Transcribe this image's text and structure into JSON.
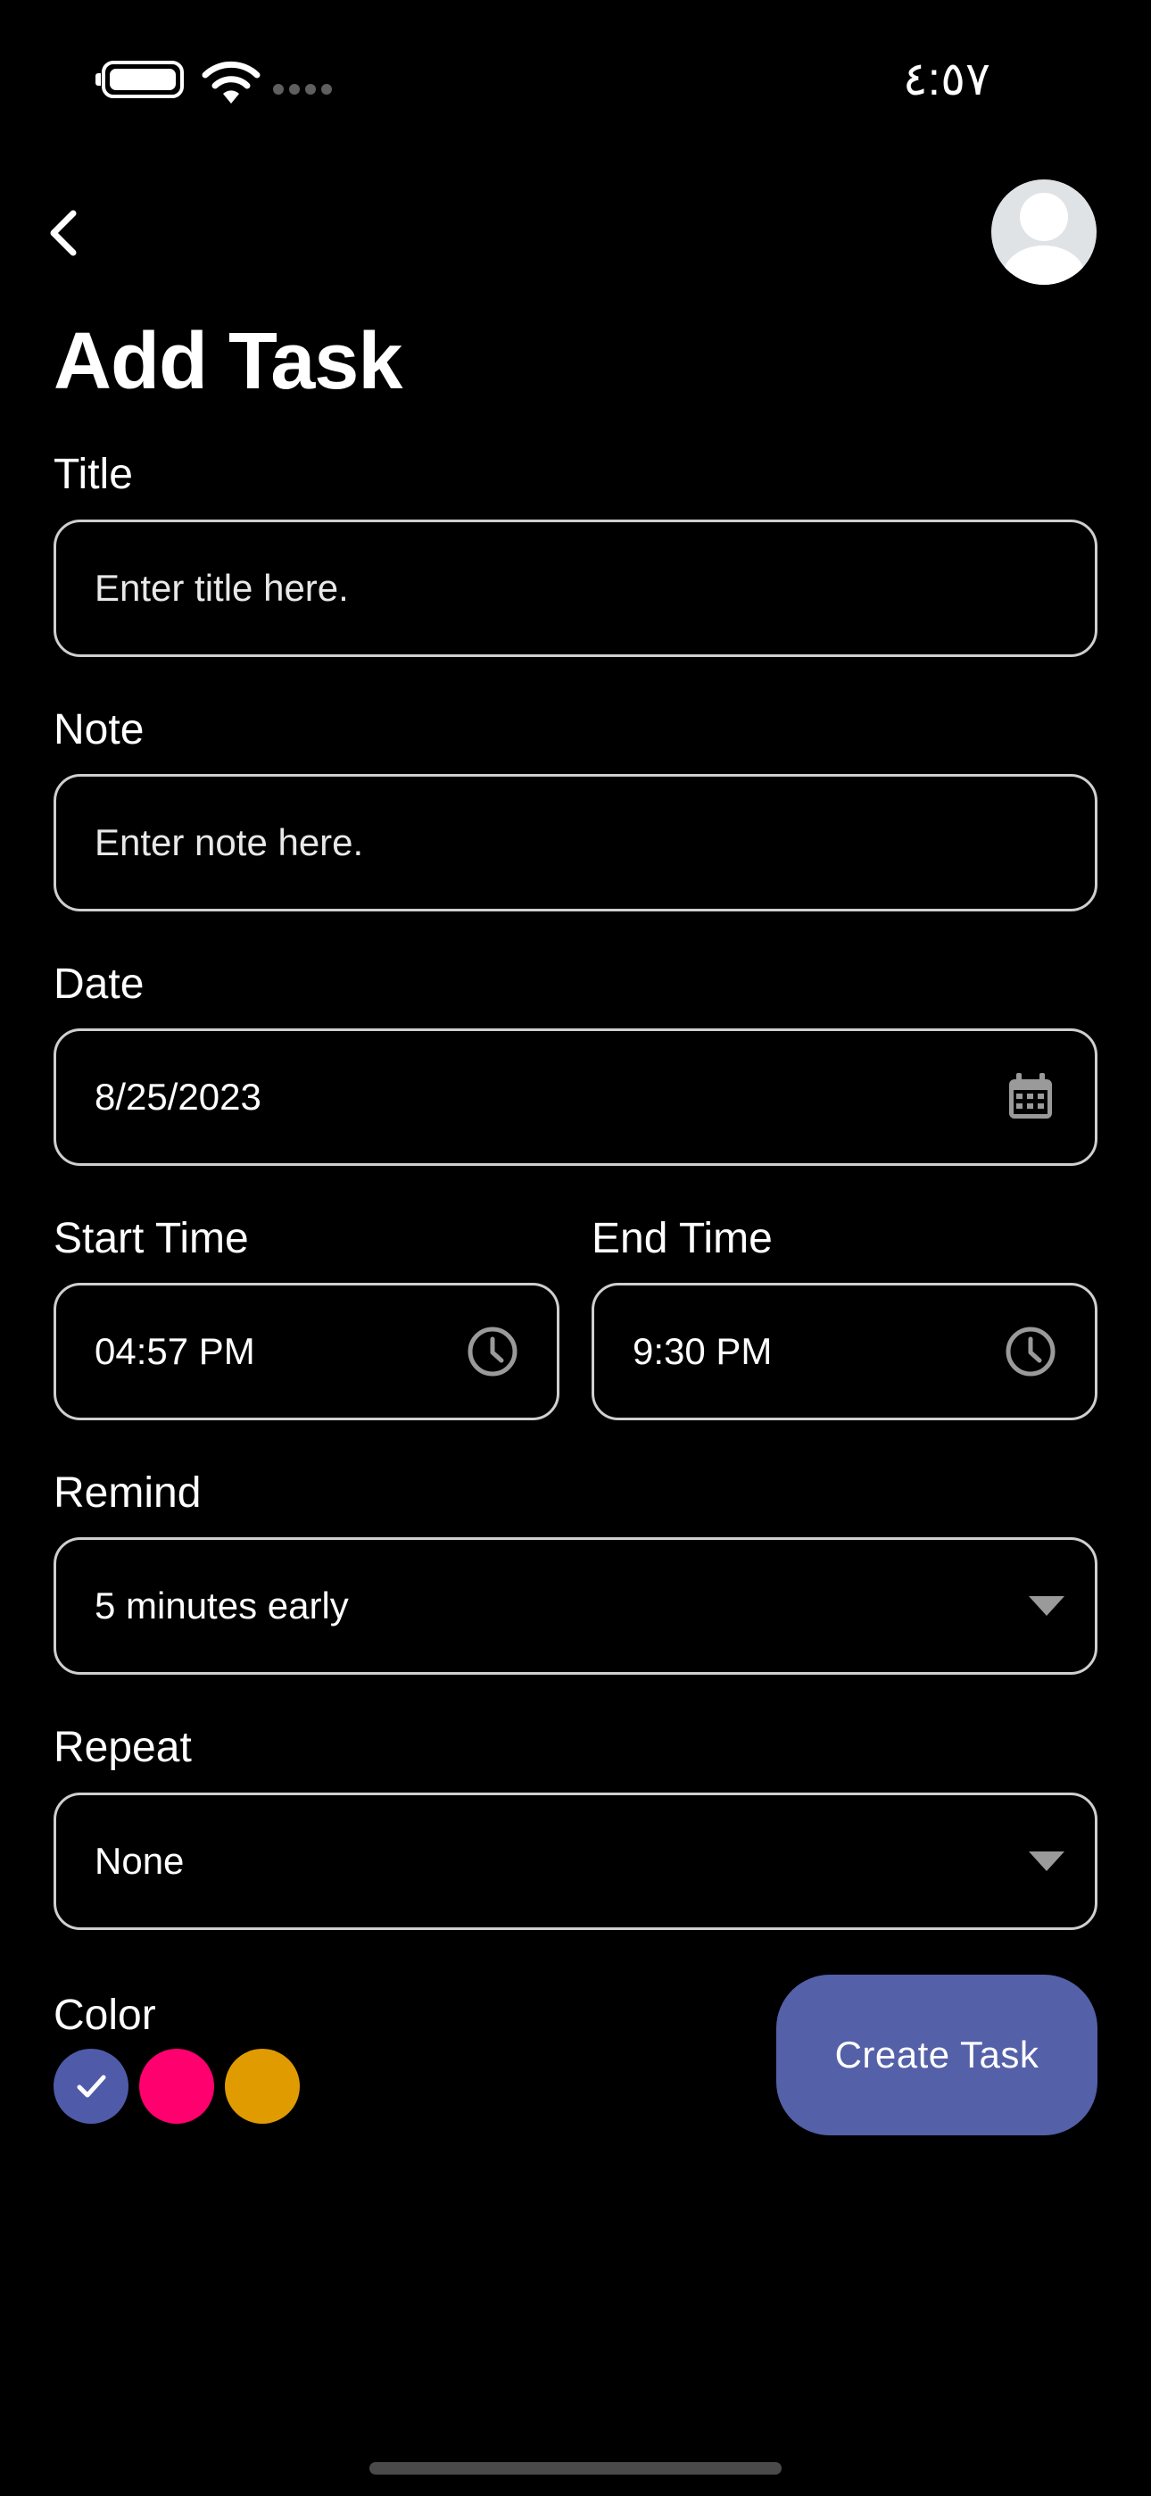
{
  "status_bar": {
    "time": "٤:٥٧"
  },
  "header": {
    "title": "Add Task"
  },
  "form": {
    "title": {
      "label": "Title",
      "placeholder": "Enter title here."
    },
    "note": {
      "label": "Note",
      "placeholder": "Enter note here."
    },
    "date": {
      "label": "Date",
      "value": "8/25/2023"
    },
    "start_time": {
      "label": "Start Time",
      "value": "04:57 PM"
    },
    "end_time": {
      "label": "End Time",
      "value": "9:30 PM"
    },
    "remind": {
      "label": "Remind",
      "value": "5 minutes early"
    },
    "repeat": {
      "label": "Repeat",
      "value": "None"
    },
    "color": {
      "label": "Color",
      "options": [
        "#4f5ba8",
        "#ff006e",
        "#e09b00"
      ],
      "selected_index": 0
    }
  },
  "actions": {
    "create_label": "Create Task"
  },
  "colors": {
    "background": "#000000",
    "border": "#cfcfcf",
    "accent": "#5460a8",
    "icon_gray": "#9a9a9a"
  }
}
